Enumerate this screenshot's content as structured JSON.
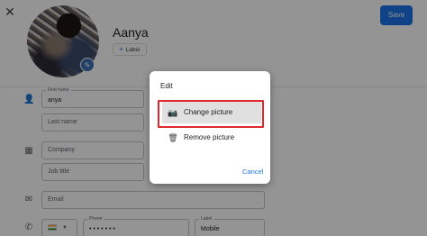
{
  "header": {
    "close_icon": "close-icon",
    "save_label": "Save"
  },
  "contact": {
    "name": "Aanya",
    "label_button": "Label"
  },
  "form": {
    "first_name_label": "First name",
    "first_name_value": "anya",
    "last_name_placeholder": "Last name",
    "company_placeholder": "Company",
    "job_title_placeholder": "Job title",
    "email_placeholder": "Email",
    "phone_label": "Phone",
    "phone_value": "• • • • • • •",
    "phone_type_label": "Label",
    "phone_type_value": "Mobile"
  },
  "dialog": {
    "title": "Edit",
    "options": [
      {
        "label": "Change picture",
        "icon": "add-photo-icon"
      },
      {
        "label": "Remove picture",
        "icon": "trash-icon"
      }
    ],
    "cancel_label": "Cancel"
  },
  "colors": {
    "accent": "#1a73e8",
    "highlight_border": "#e0282e"
  }
}
